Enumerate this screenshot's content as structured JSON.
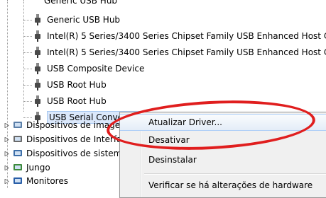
{
  "tree": {
    "partial_item": "Generic USB Hub",
    "children": [
      {
        "label": "Generic USB Hub",
        "icon": "usb-plug-icon"
      },
      {
        "label": "Intel(R) 5 Series/3400 Series Chipset Family USB Enhanced Host Co",
        "icon": "usb-plug-icon"
      },
      {
        "label": "Intel(R) 5 Series/3400 Series Chipset Family USB Enhanced Host Co",
        "icon": "usb-plug-icon"
      },
      {
        "label": "USB Composite Device",
        "icon": "usb-plug-icon"
      },
      {
        "label": "USB Root Hub",
        "icon": "usb-plug-icon"
      },
      {
        "label": "USB Root Hub",
        "icon": "usb-plug-icon"
      },
      {
        "label": "USB Serial Converter",
        "icon": "usb-plug-icon",
        "selected": true
      }
    ],
    "categories": [
      {
        "label": "Dispositivos de imagem",
        "icon": "imaging-device-icon"
      },
      {
        "label": "Dispositivos de Interface",
        "icon": "hid-device-icon"
      },
      {
        "label": "Dispositivos de sistema",
        "icon": "system-device-icon"
      },
      {
        "label": "Jungo",
        "icon": "jungo-icon"
      },
      {
        "label": "Monitores",
        "icon": "monitor-icon"
      }
    ]
  },
  "context_menu": {
    "items": [
      {
        "label": "Atualizar Driver...",
        "highlighted": true
      },
      {
        "label": "Desativar"
      },
      {
        "label": "Desinstalar"
      },
      {
        "label": "Verificar se há alterações de hardware"
      }
    ]
  },
  "colors": {
    "annotation": "#e01e1e",
    "selection": "#dbe8fb",
    "menu_bg": "#f0f0f0"
  }
}
